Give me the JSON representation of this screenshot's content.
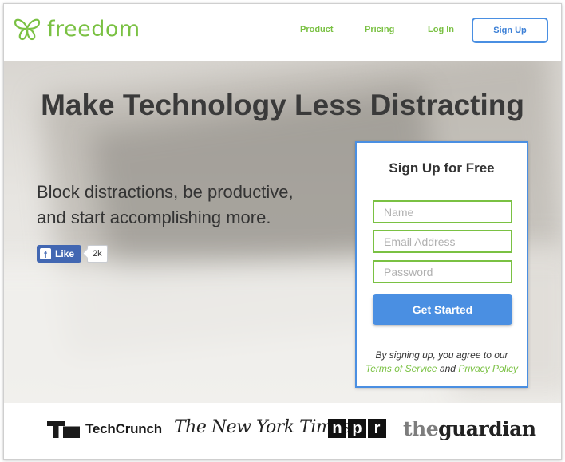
{
  "header": {
    "logo_text": "freedom",
    "nav": [
      "Product",
      "Pricing",
      "Log In"
    ],
    "signup_label": "Sign Up"
  },
  "hero": {
    "headline": "Make Technology Less Distracting",
    "subline_1": "Block distractions, be productive,",
    "subline_2": "and start accomplishing more.",
    "fb_like_label": "Like",
    "fb_like_count": "2k"
  },
  "signup_card": {
    "title": "Sign Up for Free",
    "name_placeholder": "Name",
    "email_placeholder": "Email Address",
    "password_placeholder": "Password",
    "cta_label": "Get Started",
    "legal_prefix": "By signing up, you agree to our",
    "terms_link": "Terms of Service",
    "legal_and": "and",
    "privacy_link": "Privacy Policy"
  },
  "press": {
    "techcrunch": "TechCrunch",
    "nyt": "The New York Times",
    "npr_letters": [
      "n",
      "p",
      "r"
    ],
    "guardian_the": "the",
    "guardian_name": "guardian"
  },
  "colors": {
    "brand_green": "#7ac143",
    "accent_blue": "#4a8fe2",
    "facebook_blue": "#4267b2"
  }
}
